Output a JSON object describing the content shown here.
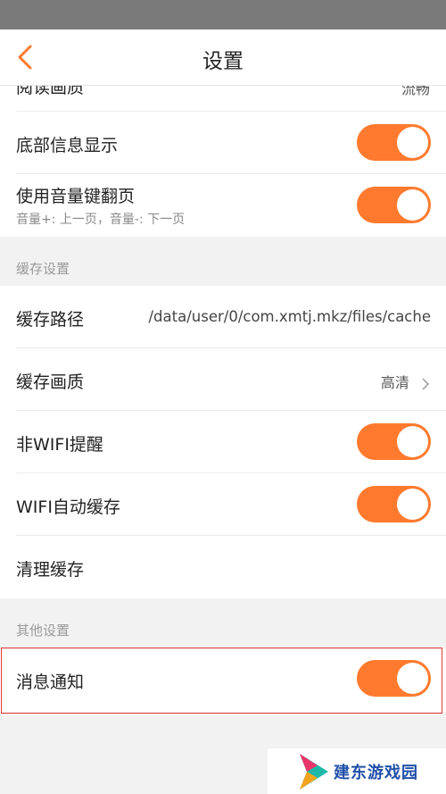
{
  "header": {
    "title": "设置"
  },
  "rows_top": {
    "partial_label": "阅读画质",
    "partial_value": "流畅",
    "bottom_info": "底部信息显示",
    "volume_flip": "使用音量键翻页",
    "volume_flip_sub": "音量+: 上一页，音量-: 下一页"
  },
  "cache_section": {
    "title": "缓存设置",
    "path_label": "缓存路径",
    "path_value": "/data/user/0/com.xmtj.mkz/files/cache",
    "quality_label": "缓存画质",
    "quality_value": "高清",
    "non_wifi_label": "非WIFI提醒",
    "wifi_auto_label": "WIFI自动缓存",
    "clear_label": "清理缓存"
  },
  "other_section": {
    "title": "其他设置",
    "notify_label": "消息通知"
  },
  "toggles": {
    "bottom_info": true,
    "volume_flip": true,
    "non_wifi": true,
    "wifi_auto": true,
    "notify": true
  },
  "colors": {
    "accent": "#ff7a2e",
    "highlight": "#e53935"
  },
  "watermark": {
    "text": "建东游戏园"
  }
}
